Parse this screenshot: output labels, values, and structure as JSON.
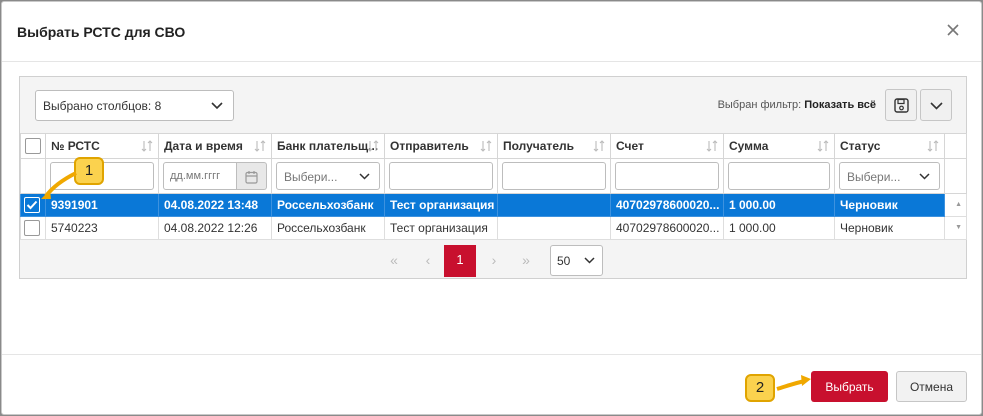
{
  "dialog": {
    "title": "Выбрать РСТС для СВО"
  },
  "toolbar": {
    "columns_select": "Выбрано столбцов: 8",
    "filter_prefix": "Выбран фильтр:",
    "filter_value": "Показать всё"
  },
  "grid": {
    "headers": [
      "№ РСТС",
      "Дата и время",
      "Банк плательщ...",
      "Отправитель",
      "Получатель",
      "Счет",
      "Сумма",
      "Статус"
    ],
    "filters": {
      "date_placeholder": "дд.мм.гггг",
      "bank_select": "Выбери...",
      "status_select": "Выбери..."
    },
    "rows": [
      {
        "selected": true,
        "cells": [
          "9391901",
          "04.08.2022 13:48",
          "Россельхозбанк",
          "Тест организация",
          "",
          "40702978600020...",
          "1 000.00",
          "Черновик"
        ]
      },
      {
        "selected": false,
        "cells": [
          "5740223",
          "04.08.2022 12:26",
          "Россельхозбанк",
          "Тест организация",
          "",
          "40702978600020...",
          "1 000.00",
          "Черновик"
        ]
      }
    ]
  },
  "pager": {
    "first": "«",
    "prev": "‹",
    "current_page": "1",
    "next": "›",
    "last": "»",
    "page_size": "50"
  },
  "footer": {
    "select_label": "Выбрать",
    "cancel_label": "Отмена"
  },
  "callouts": [
    "1",
    "2"
  ],
  "colors": {
    "accent_red": "#c8102e",
    "selected_row": "#0a78d7",
    "callout_yellow": "#fbd24e"
  }
}
